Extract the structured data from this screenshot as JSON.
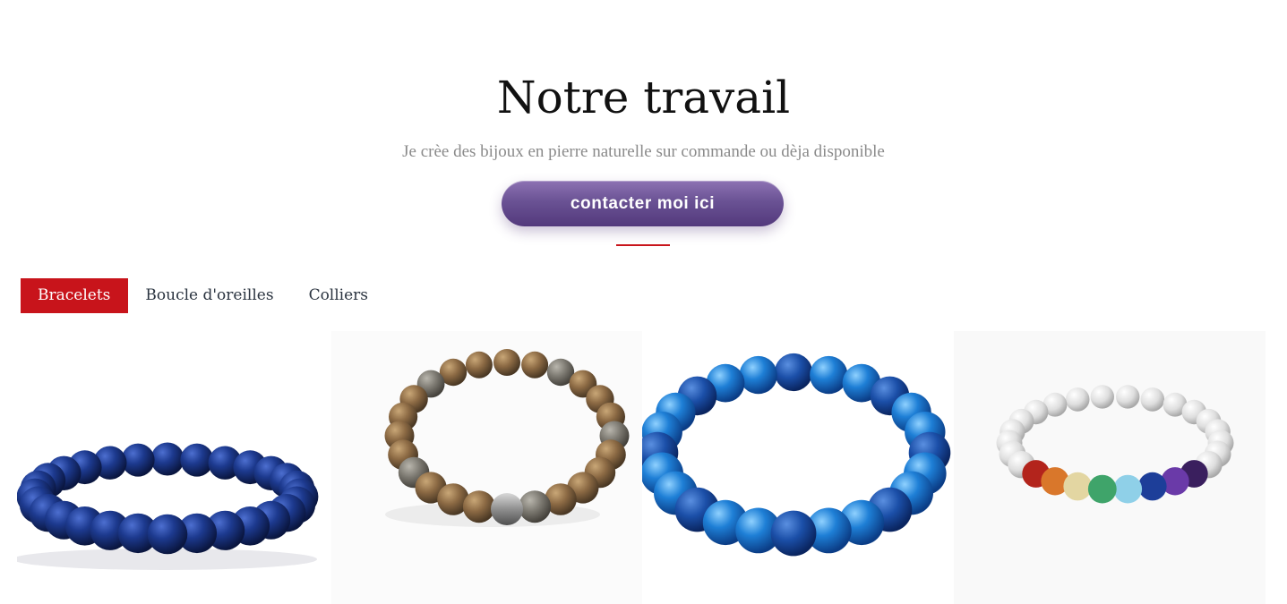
{
  "header": {
    "title": "Notre travail",
    "subtitle": "Je crèe des bijoux en pierre naturelle sur commande ou dèja disponible",
    "cta_label": "contacter moi ici"
  },
  "tabs": [
    {
      "label": "Bracelets",
      "active": true
    },
    {
      "label": "Boucle d'oreilles",
      "active": false
    },
    {
      "label": "Colliers",
      "active": false
    }
  ],
  "products": [
    {
      "name": "bracelet-blue-tiger-eye",
      "icon": "bracelet-image"
    },
    {
      "name": "bracelet-wood-jasper",
      "icon": "bracelet-image"
    },
    {
      "name": "bracelet-blue-agate",
      "icon": "bracelet-image"
    },
    {
      "name": "bracelet-chakra-howlite",
      "icon": "bracelet-image"
    }
  ],
  "colors": {
    "accent_red": "#c8141b",
    "button_purple": "#6a5294",
    "subtitle_gray": "#8a8a8a"
  }
}
